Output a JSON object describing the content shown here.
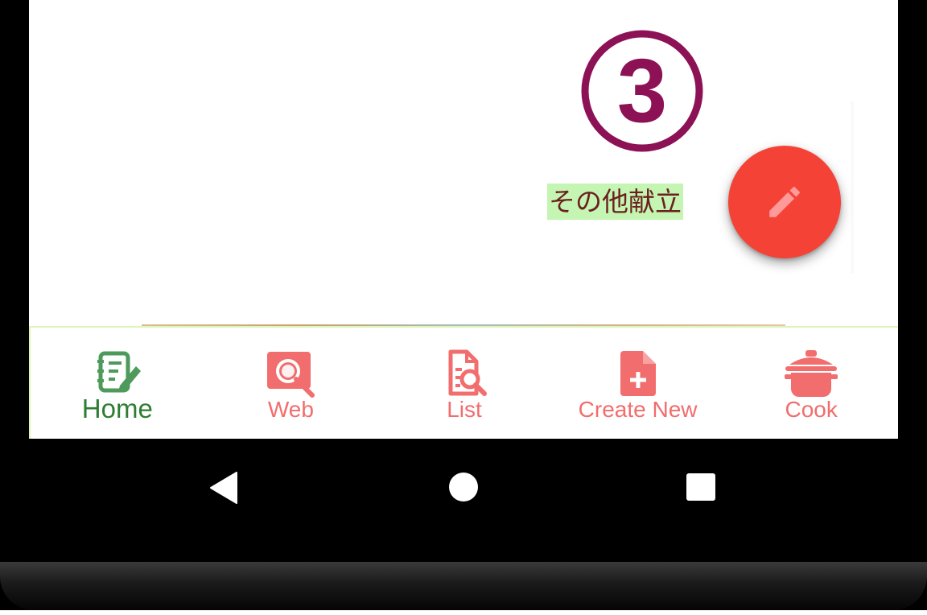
{
  "content": {
    "step_number": "3",
    "category_label": "その他献立"
  },
  "fab": {
    "icon": "pencil-icon",
    "color": "#f44336"
  },
  "bottom_nav": {
    "items": [
      {
        "label": "Home",
        "icon": "edit-document-icon",
        "active": true
      },
      {
        "label": "Web",
        "icon": "web-search-icon",
        "active": false
      },
      {
        "label": "List",
        "icon": "document-search-icon",
        "active": false
      },
      {
        "label": "Create New",
        "icon": "new-file-icon",
        "active": false
      },
      {
        "label": "Cook",
        "icon": "cooking-pot-icon",
        "active": false
      }
    ],
    "active_color": "#2e7d32",
    "inactive_color": "#f26d6d"
  },
  "system_nav": {
    "back": "back-triangle-icon",
    "home": "home-circle-icon",
    "recents": "recents-square-icon"
  }
}
